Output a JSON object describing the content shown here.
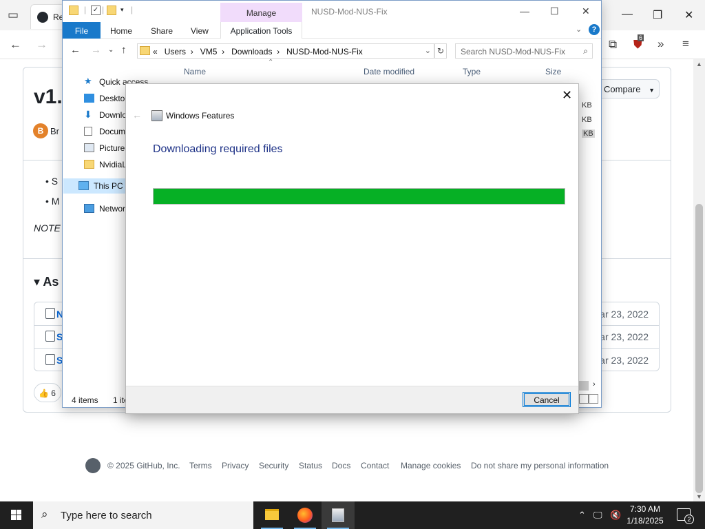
{
  "browser": {
    "tab_title": "Re",
    "extensions_badge": "6"
  },
  "github": {
    "release_title": "v1.",
    "author": "Br",
    "compare_label": "Compare",
    "bullets": [
      "S",
      "M"
    ],
    "note": "NOTE",
    "assets_heading": "As",
    "assets": [
      {
        "name": "N",
        "date": "ar 23, 2022"
      },
      {
        "name": "S",
        "date": "ar 23, 2022"
      },
      {
        "name": "S",
        "date": "ar 23, 2022"
      }
    ],
    "reaction_count": "6",
    "footer": {
      "copyright": "© 2025 GitHub, Inc.",
      "links": [
        "Terms",
        "Privacy",
        "Security",
        "Status",
        "Docs",
        "Contact",
        "Manage cookies",
        "Do not share my personal information"
      ]
    }
  },
  "explorer": {
    "window_title": "NUSD-Mod-NUS-Fix",
    "manage_tab": "Manage",
    "ribbon_tabs": {
      "file": "File",
      "home": "Home",
      "share": "Share",
      "view": "View",
      "app_tools": "Application Tools"
    },
    "breadcrumb": {
      "overflow": "«",
      "parts": [
        "Users",
        "VM5",
        "Downloads",
        "NUSD-Mod-NUS-Fix"
      ]
    },
    "search_placeholder": "Search NUSD-Mod-NUS-Fix",
    "columns": {
      "name": "Name",
      "date_modified": "Date modified",
      "type": "Type",
      "size": "Size"
    },
    "sidebar": [
      {
        "label": "Quick access",
        "icon": "star-icon"
      },
      {
        "label": "Desktop",
        "icon": "desktop-icon"
      },
      {
        "label": "Downlo",
        "icon": "download-icon"
      },
      {
        "label": "Docum",
        "icon": "document-icon"
      },
      {
        "label": "Pictures",
        "icon": "pictures-icon"
      },
      {
        "label": "NvidiaL",
        "icon": "folder-icon"
      },
      {
        "label": "This PC",
        "icon": "computer-icon"
      },
      {
        "label": "Network",
        "icon": "network-icon"
      }
    ],
    "size_values": [
      "KB",
      "KB",
      "KB"
    ],
    "status": {
      "items": "4 items",
      "selected": "1 ite"
    }
  },
  "dialog": {
    "title": "Windows Features",
    "heading": "Downloading required files",
    "progress": 1.0,
    "cancel_label": "Cancel",
    "progress_color": "#06b025"
  },
  "taskbar": {
    "search_placeholder": "Type here to search",
    "time": "7:30 AM",
    "date": "1/18/2025",
    "notifications": "2"
  }
}
